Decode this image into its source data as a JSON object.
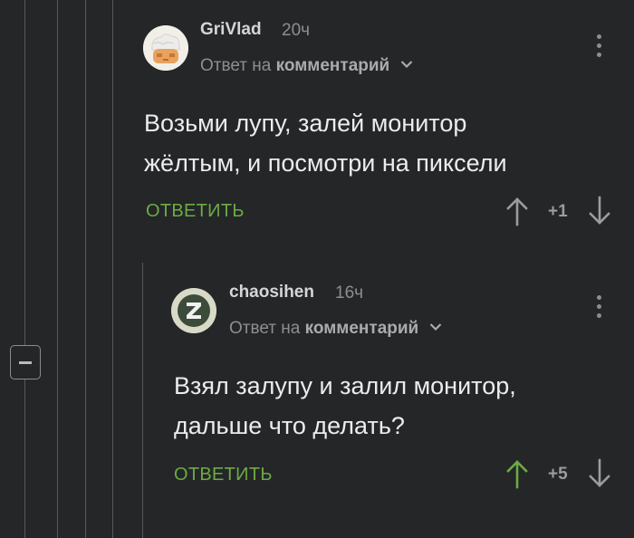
{
  "colors": {
    "background": "#242628",
    "accent_green": "#6cab44",
    "muted_text": "#8c8f92",
    "thread_line": "#56595c"
  },
  "comments": [
    {
      "username": "GriVlad",
      "time": "20ч",
      "reply_prefix": "Ответ на",
      "reply_target": "комментарий",
      "text_line1": "Возьми лупу, залей монитор",
      "text_line2": "жёлтым, и посмотри на пиксели",
      "reply_label": "ОТВЕТИТЬ",
      "rating": "+1",
      "upvoted": false
    },
    {
      "username": "chaosihen",
      "time": "16ч",
      "reply_prefix": "Ответ на",
      "reply_target": "комментарий",
      "avatar_letter": "Z",
      "text_line1": "Взял залупу и залил монитор,",
      "text_line2": "дальше что делать?",
      "reply_label": "ОТВЕТИТЬ",
      "rating": "+5",
      "upvoted": true
    }
  ],
  "icons": {
    "collapse": "minus-square-icon",
    "menu": "more-vertical-icon",
    "upvote": "arrow-up-icon",
    "downvote": "arrow-down-icon",
    "expand": "chevron-down-icon"
  }
}
